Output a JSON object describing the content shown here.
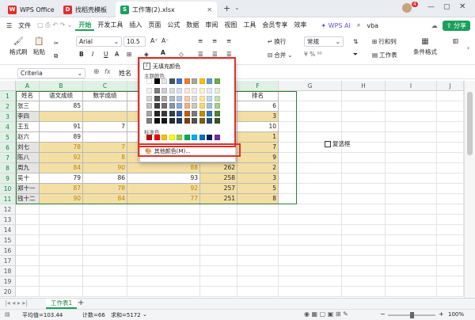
{
  "titlebar": {
    "tabs": [
      {
        "label": "WPS Office",
        "icon": "wps-logo-icon",
        "color": "#e0302a"
      },
      {
        "label": "找稻壳模板",
        "icon": "docer-logo-icon",
        "color": "#e0302a"
      },
      {
        "label": "工作簿(2).xlsx",
        "icon": "spreadsheet-logo-icon",
        "color": "#1aa05b"
      }
    ],
    "plus": "+",
    "avatar_count": "4"
  },
  "menubar": {
    "file": "文件",
    "items": [
      "开始",
      "开发工具",
      "插入",
      "页面",
      "公式",
      "数据",
      "审阅",
      "视图",
      "工具",
      "会员专享",
      "效率"
    ],
    "active_index": 0,
    "ai": "WPS AI",
    "vba": "vba",
    "share": "分享"
  },
  "toolbar": {
    "format_painter": "格式刷",
    "paste": "粘贴",
    "font_name": "Arial",
    "font_size": "10.5",
    "bold": "B",
    "italic": "I",
    "underline": "U",
    "wrap": "换行",
    "merge": "合并",
    "number_format": "常规",
    "rows_cols": "行和列",
    "worksheet": "工作表",
    "cond_format": "条件格式",
    "accent_color": "#e0302a"
  },
  "formulabar": {
    "cell_ref": "Criteria",
    "fx": "fx",
    "content": "姓名"
  },
  "columns": [
    "A",
    "B",
    "C",
    "D",
    "E",
    "F",
    "G",
    "H",
    "I",
    "J"
  ],
  "rows": [
    "1",
    "2",
    "3",
    "4",
    "5",
    "6",
    "7",
    "8",
    "9",
    "10",
    "11",
    "12",
    "13",
    "14",
    "15",
    "16",
    "17",
    "18",
    "19",
    "20",
    "21",
    "22",
    "23",
    "24",
    "25",
    "26"
  ],
  "table": {
    "headers": [
      "姓名",
      "语文成绩",
      "数学成绩",
      "",
      "成绩",
      "排名"
    ],
    "rows": [
      {
        "name": "张三",
        "chinese": "85",
        "math": "",
        "d": "",
        "total": "255",
        "rank": "6"
      },
      {
        "name": "李四",
        "chinese": "",
        "math": "",
        "d": "",
        "total": "258",
        "rank": "3"
      },
      {
        "name": "王五",
        "chinese": "91",
        "math": "7",
        "d": "",
        "total": "246",
        "rank": "10"
      },
      {
        "name": "赵六",
        "chinese": "89",
        "math": "",
        "d": "",
        "total": "271",
        "rank": "1"
      },
      {
        "name": "刘七",
        "chinese": "78",
        "math": "7",
        "d": "",
        "total": "262",
        "rank": "7"
      },
      {
        "name": "陈八",
        "chinese": "92",
        "math": "8",
        "d": "",
        "total": "249",
        "rank": "9"
      },
      {
        "name": "周九",
        "chinese": "84",
        "math": "90",
        "d": "88",
        "total": "262",
        "rank": "2"
      },
      {
        "name": "吴十",
        "chinese": "79",
        "math": "86",
        "d": "93",
        "total": "258",
        "rank": "3"
      },
      {
        "name": "郑十一",
        "chinese": "87",
        "math": "78",
        "d": "92",
        "total": "257",
        "rank": "5"
      },
      {
        "name": "钱十二",
        "chinese": "90",
        "math": "84",
        "d": "77",
        "total": "251",
        "rank": "8"
      }
    ]
  },
  "checkbox_label": "复选框",
  "dropdown": {
    "no_fill": "无填充颜色",
    "theme_title": "主题颜色",
    "standard_title": "标准色",
    "more_colors": "其他颜色(M)...",
    "theme_top": [
      "#ffffff",
      "#000000",
      "#e7e6e6",
      "#44546a",
      "#4472c4",
      "#ed7d31",
      "#a5a5a5",
      "#ffc000",
      "#5b9bd5",
      "#70ad47"
    ],
    "theme_shades": [
      [
        "#f2f2f2",
        "#7f7f7f",
        "#d0cece",
        "#d6dce4",
        "#d9e2f3",
        "#fbe5d5",
        "#ededed",
        "#fff2cc",
        "#deebf6",
        "#e2efd9"
      ],
      [
        "#d8d8d8",
        "#595959",
        "#aeaaaa",
        "#adb9ca",
        "#b4c6e7",
        "#f7cbac",
        "#dbdbdb",
        "#fee599",
        "#bdd7ee",
        "#c5e0b3"
      ],
      [
        "#bfbfbf",
        "#3f3f3f",
        "#757070",
        "#8496b0",
        "#8eaadb",
        "#f4b183",
        "#c9c9c9",
        "#ffd965",
        "#9cc3e5",
        "#a8d08d"
      ],
      [
        "#a5a5a5",
        "#262626",
        "#3a3838",
        "#323f4f",
        "#2f5496",
        "#c55a11",
        "#7b7b7b",
        "#bf8f00",
        "#2e75b5",
        "#538135"
      ],
      [
        "#7f7f7f",
        "#0c0c0c",
        "#171616",
        "#222a35",
        "#1f3864",
        "#833c0b",
        "#525252",
        "#7f6000",
        "#1e4e79",
        "#375623"
      ]
    ],
    "standard": [
      "#c00000",
      "#ff0000",
      "#ffc000",
      "#ffff00",
      "#92d050",
      "#00b050",
      "#00b0f0",
      "#0070c0",
      "#002060",
      "#7030a0"
    ]
  },
  "sheets": {
    "active": "工作表1",
    "add": "+"
  },
  "status": {
    "average": "平均值=103.44",
    "count": "计数=66",
    "sum": "求和=5172",
    "zoom": "100%"
  }
}
